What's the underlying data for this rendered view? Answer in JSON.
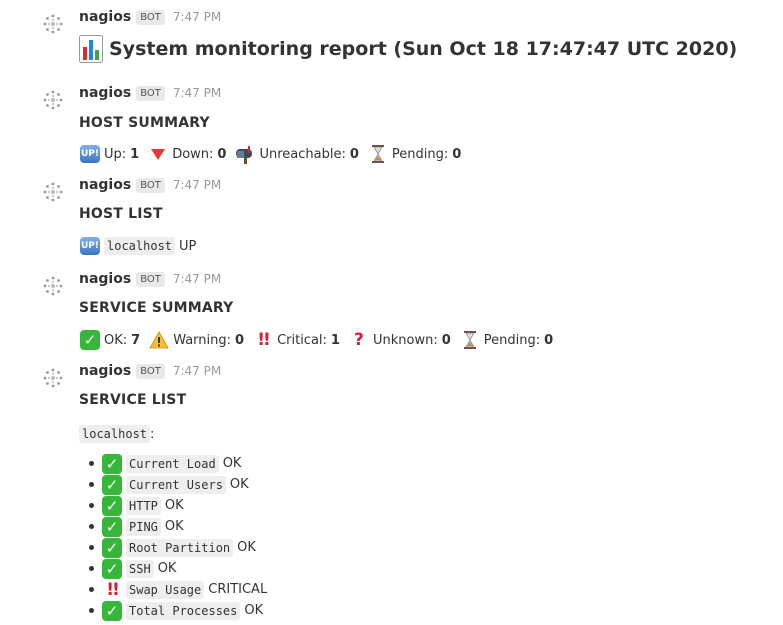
{
  "messages": [
    {
      "sender": "nagios",
      "badge": "BOT",
      "time": "7:47 PM",
      "title": "System monitoring report (Sun Oct 18 17:47:47 UTC 2020)"
    },
    {
      "sender": "nagios",
      "badge": "BOT",
      "time": "7:47 PM",
      "heading": "HOST SUMMARY",
      "items": [
        {
          "label": "Up:",
          "value": "1"
        },
        {
          "label": "Down:",
          "value": "0"
        },
        {
          "label": "Unreachable:",
          "value": "0"
        },
        {
          "label": "Pending:",
          "value": "0"
        }
      ]
    },
    {
      "sender": "nagios",
      "badge": "BOT",
      "time": "7:47 PM",
      "heading": "HOST LIST",
      "host": {
        "badge": "UP!",
        "name": "localhost",
        "status": "UP"
      }
    },
    {
      "sender": "nagios",
      "badge": "BOT",
      "time": "7:47 PM",
      "heading": "SERVICE SUMMARY",
      "items": [
        {
          "label": "OK:",
          "value": "7"
        },
        {
          "label": "Warning:",
          "value": "0"
        },
        {
          "label": "Critical:",
          "value": "1"
        },
        {
          "label": "Unknown:",
          "value": "0"
        },
        {
          "label": "Pending:",
          "value": "0"
        }
      ]
    },
    {
      "sender": "nagios",
      "badge": "BOT",
      "time": "7:47 PM",
      "heading": "SERVICE LIST",
      "host": "localhost",
      "colon": ":",
      "services": [
        {
          "icon": "check",
          "name": "Current Load",
          "status": "OK"
        },
        {
          "icon": "check",
          "name": "Current Users",
          "status": "OK"
        },
        {
          "icon": "check",
          "name": "HTTP",
          "status": "OK"
        },
        {
          "icon": "check",
          "name": "PING",
          "status": "OK"
        },
        {
          "icon": "check",
          "name": "Root Partition",
          "status": "OK"
        },
        {
          "icon": "check",
          "name": "SSH",
          "status": "OK"
        },
        {
          "icon": "double-exclamation",
          "name": "Swap Usage",
          "status": "CRITICAL"
        },
        {
          "icon": "check",
          "name": "Total Processes",
          "status": "OK"
        }
      ]
    }
  ],
  "icons": {
    "up_badge_text": "UP!",
    "check_glyph": "✓",
    "bangbang_glyph": "!!",
    "question_glyph": "?"
  },
  "colors": {
    "ok_green": "#36b73a",
    "critical_red": "#e0192f",
    "up_blue": "#3b74c2"
  }
}
